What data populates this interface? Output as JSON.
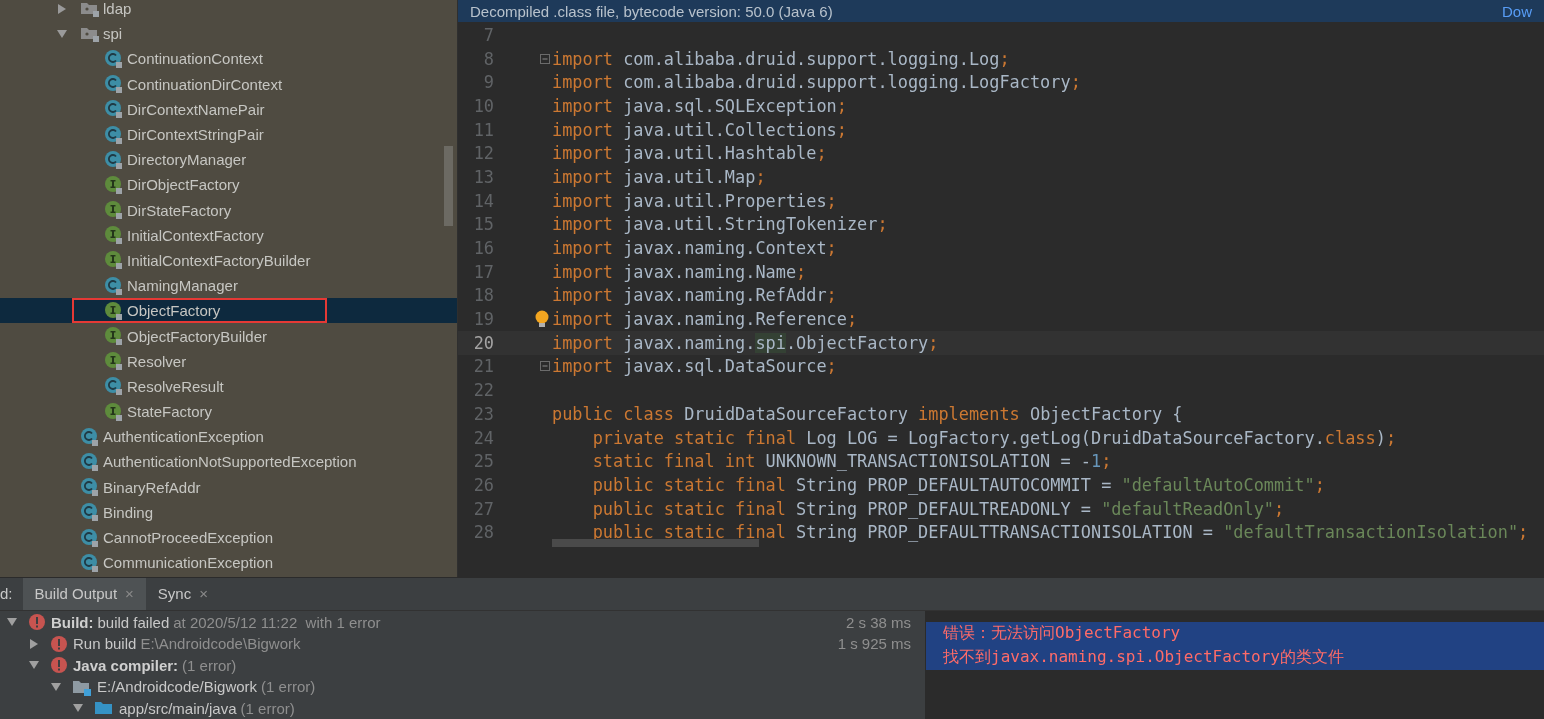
{
  "project_tree": [
    {
      "label": "ldap",
      "kind": "package",
      "expanded": false,
      "selected": false
    },
    {
      "label": "spi",
      "kind": "package",
      "expanded": true,
      "selected": false,
      "children": [
        {
          "label": "ContinuationContext",
          "kind": "class",
          "selected": false
        },
        {
          "label": "ContinuationDirContext",
          "kind": "class",
          "selected": false
        },
        {
          "label": "DirContextNamePair",
          "kind": "class",
          "selected": false
        },
        {
          "label": "DirContextStringPair",
          "kind": "class",
          "selected": false
        },
        {
          "label": "DirectoryManager",
          "kind": "class",
          "selected": false
        },
        {
          "label": "DirObjectFactory",
          "kind": "interface",
          "selected": false
        },
        {
          "label": "DirStateFactory",
          "kind": "interface",
          "selected": false
        },
        {
          "label": "InitialContextFactory",
          "kind": "interface",
          "selected": false
        },
        {
          "label": "InitialContextFactoryBuilder",
          "kind": "interface",
          "selected": false
        },
        {
          "label": "NamingManager",
          "kind": "class",
          "selected": false
        },
        {
          "label": "ObjectFactory",
          "kind": "interface",
          "selected": true,
          "annotated": true
        },
        {
          "label": "ObjectFactoryBuilder",
          "kind": "interface",
          "selected": false
        },
        {
          "label": "Resolver",
          "kind": "interface",
          "selected": false
        },
        {
          "label": "ResolveResult",
          "kind": "class",
          "selected": false
        },
        {
          "label": "StateFactory",
          "kind": "interface",
          "selected": false
        }
      ]
    },
    {
      "label": "AuthenticationException",
      "kind": "class",
      "selected": false
    },
    {
      "label": "AuthenticationNotSupportedException",
      "kind": "class",
      "selected": false
    },
    {
      "label": "BinaryRefAddr",
      "kind": "class",
      "selected": false
    },
    {
      "label": "Binding",
      "kind": "class",
      "selected": false
    },
    {
      "label": "CannotProceedException",
      "kind": "class",
      "selected": false
    },
    {
      "label": "CommunicationException",
      "kind": "class",
      "selected": false
    }
  ],
  "editor": {
    "banner": "Decompiled .class file, bytecode version: 50.0 (Java 6)",
    "banner_link": "Dow",
    "lines": [
      {
        "number": "7"
      },
      {
        "number": "8",
        "fold": true,
        "segments": [
          {
            "kind": "keyword",
            "text": "import"
          },
          {
            "kind": "plain",
            "text": " com.alibaba.druid.support.logging.Log"
          },
          {
            "kind": "keyword",
            "text": ";"
          }
        ]
      },
      {
        "number": "9",
        "segments": [
          {
            "kind": "keyword",
            "text": "import"
          },
          {
            "kind": "plain",
            "text": " com.alibaba.druid.support.logging.LogFactory"
          },
          {
            "kind": "keyword",
            "text": ";"
          }
        ]
      },
      {
        "number": "10",
        "segments": [
          {
            "kind": "keyword",
            "text": "import"
          },
          {
            "kind": "plain",
            "text": " java.sql.SQLException"
          },
          {
            "kind": "keyword",
            "text": ";"
          }
        ]
      },
      {
        "number": "11",
        "segments": [
          {
            "kind": "keyword",
            "text": "import"
          },
          {
            "kind": "plain",
            "text": " java.util.Collections"
          },
          {
            "kind": "keyword",
            "text": ";"
          }
        ]
      },
      {
        "number": "12",
        "segments": [
          {
            "kind": "keyword",
            "text": "import"
          },
          {
            "kind": "plain",
            "text": " java.util.Hashtable"
          },
          {
            "kind": "keyword",
            "text": ";"
          }
        ]
      },
      {
        "number": "13",
        "segments": [
          {
            "kind": "keyword",
            "text": "import"
          },
          {
            "kind": "plain",
            "text": " java.util.Map"
          },
          {
            "kind": "keyword",
            "text": ";"
          }
        ]
      },
      {
        "number": "14",
        "segments": [
          {
            "kind": "keyword",
            "text": "import"
          },
          {
            "kind": "plain",
            "text": " java.util.Properties"
          },
          {
            "kind": "keyword",
            "text": ";"
          }
        ]
      },
      {
        "number": "15",
        "segments": [
          {
            "kind": "keyword",
            "text": "import"
          },
          {
            "kind": "plain",
            "text": " java.util.StringTokenizer"
          },
          {
            "kind": "keyword",
            "text": ";"
          }
        ]
      },
      {
        "number": "16",
        "segments": [
          {
            "kind": "keyword",
            "text": "import"
          },
          {
            "kind": "plain",
            "text": " javax.naming.Context"
          },
          {
            "kind": "keyword",
            "text": ";"
          }
        ]
      },
      {
        "number": "17",
        "segments": [
          {
            "kind": "keyword",
            "text": "import"
          },
          {
            "kind": "plain",
            "text": " javax.naming.Name"
          },
          {
            "kind": "keyword",
            "text": ";"
          }
        ]
      },
      {
        "number": "18",
        "segments": [
          {
            "kind": "keyword",
            "text": "import"
          },
          {
            "kind": "plain",
            "text": " javax.naming.RefAddr"
          },
          {
            "kind": "keyword",
            "text": ";"
          }
        ]
      },
      {
        "number": "19",
        "bulb": true,
        "segments": [
          {
            "kind": "keyword",
            "text": "import"
          },
          {
            "kind": "plain",
            "text": " javax.naming.Reference"
          },
          {
            "kind": "keyword",
            "text": ";"
          }
        ]
      },
      {
        "number": "20",
        "current": true,
        "segments": [
          {
            "kind": "keyword",
            "text": "import"
          },
          {
            "kind": "plain",
            "text": " javax.naming."
          },
          {
            "kind": "unresolved",
            "text": "spi"
          },
          {
            "kind": "plain",
            "text": ".ObjectFactory"
          },
          {
            "kind": "keyword",
            "text": ";"
          }
        ]
      },
      {
        "number": "21",
        "fold": true,
        "segments": [
          {
            "kind": "keyword",
            "text": "import"
          },
          {
            "kind": "plain",
            "text": " javax.sql.DataSource"
          },
          {
            "kind": "keyword",
            "text": ";"
          }
        ]
      },
      {
        "number": "22"
      },
      {
        "number": "23",
        "segments": [
          {
            "kind": "keyword",
            "text": "public class"
          },
          {
            "kind": "plain",
            "text": " DruidDataSourceFactory "
          },
          {
            "kind": "keyword",
            "text": "implements"
          },
          {
            "kind": "plain",
            "text": " ObjectFactory {"
          }
        ]
      },
      {
        "number": "24",
        "indented": true,
        "segments": [
          {
            "kind": "keyword",
            "text": "private static final"
          },
          {
            "kind": "plain",
            "text": " Log LOG = LogFactory.getLog(DruidDataSourceFactory."
          },
          {
            "kind": "keyword",
            "text": "class"
          },
          {
            "kind": "plain",
            "text": ")"
          },
          {
            "kind": "keyword",
            "text": ";"
          }
        ]
      },
      {
        "number": "25",
        "indented": true,
        "segments": [
          {
            "kind": "keyword",
            "text": "static final int"
          },
          {
            "kind": "plain",
            "text": " UNKNOWN_TRANSACTIONISOLATION = -"
          },
          {
            "kind": "number",
            "text": "1"
          },
          {
            "kind": "keyword",
            "text": ";"
          }
        ]
      },
      {
        "number": "26",
        "indented": true,
        "segments": [
          {
            "kind": "keyword",
            "text": "public static final"
          },
          {
            "kind": "plain",
            "text": " String PROP_DEFAULTAUTOCOMMIT = "
          },
          {
            "kind": "string",
            "text": "\"defaultAutoCommit\""
          },
          {
            "kind": "keyword",
            "text": ";"
          }
        ]
      },
      {
        "number": "27",
        "indented": true,
        "segments": [
          {
            "kind": "keyword",
            "text": "public static final"
          },
          {
            "kind": "plain",
            "text": " String PROP_DEFAULTREADONLY = "
          },
          {
            "kind": "string",
            "text": "\"defaultReadOnly\""
          },
          {
            "kind": "keyword",
            "text": ";"
          }
        ]
      },
      {
        "number": "28",
        "indented": true,
        "segments": [
          {
            "kind": "keyword",
            "text": "public static final"
          },
          {
            "kind": "plain",
            "text": " String PROP_DEFAULTTRANSACTIONISOLATION = "
          },
          {
            "kind": "string",
            "text": "\"defaultTransactionIsolation\""
          },
          {
            "kind": "keyword",
            "text": ";"
          }
        ]
      }
    ]
  },
  "build_panel": {
    "label": "d:",
    "tabs": [
      {
        "label": "Build Output",
        "close": "×",
        "selected": true
      },
      {
        "label": "Sync",
        "close": "×",
        "selected": false
      }
    ],
    "tree": [
      {
        "kind": "error",
        "expanded": true,
        "title": "Build:",
        "text": "build failed",
        "detail": "at 2020/5/12 11:22  with 1 error",
        "time": "2 s 38 ms",
        "children": [
          {
            "kind": "error",
            "expanded": false,
            "text": "Run build",
            "detail": "E:\\Androidcode\\Bigwork",
            "time": "1 s 925 ms"
          },
          {
            "kind": "error",
            "expanded": true,
            "title": "Java compiler:",
            "detail": "(1 error)",
            "children": [
              {
                "kind": "module",
                "expanded": true,
                "text": "E:/Androidcode/Bigwork",
                "detail": "(1 error)",
                "children": [
                  {
                    "kind": "folder",
                    "expanded": true,
                    "text": "app/src/main/java",
                    "detail": "(1 error)"
                  }
                ]
              }
            ]
          }
        ]
      }
    ],
    "console": [
      {
        "text": "错误：无法访问ObjectFactory",
        "selected": true
      },
      {
        "text": "找不到javax.naming.spi.ObjectFactory的类文件",
        "selected": true
      }
    ]
  }
}
